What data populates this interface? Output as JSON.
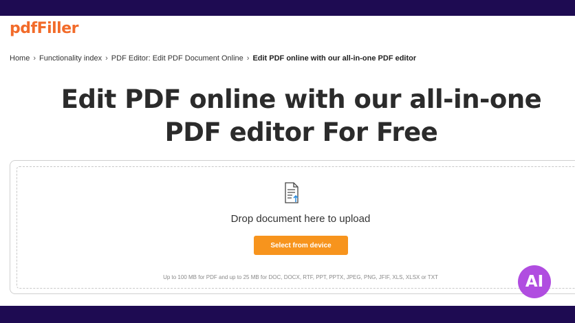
{
  "brand": {
    "logo_text": "pdfFiller",
    "accent_color": "#f26b2a"
  },
  "breadcrumb": {
    "items": [
      "Home",
      "Functionality index",
      "PDF Editor: Edit PDF Document Online",
      "Edit PDF online with our all-in-one PDF editor"
    ],
    "separator": "›"
  },
  "hero": {
    "title_line1": "Edit PDF online with our all-in-one",
    "title_line2": "PDF editor For Free"
  },
  "upload": {
    "drop_text": "Drop document here to upload",
    "button_label": "Select from device",
    "button_color": "#f7941d",
    "limits_text": "Up to 100 MB for PDF and up to 25 MB for DOC, DOCX, RTF, PPT, PPTX, JPEG, PNG, JFIF, XLS, XLSX or TXT",
    "icon": "document-upload-icon"
  },
  "ai_badge": {
    "label": "AI",
    "color": "#b04de0"
  }
}
